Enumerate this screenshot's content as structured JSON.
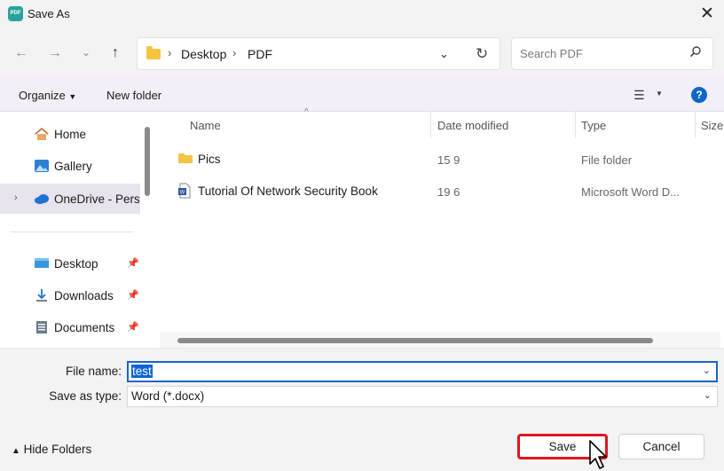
{
  "window": {
    "title": "Save As",
    "app_icon_text": "PDF"
  },
  "navigation": {
    "breadcrumb": [
      "Desktop",
      "PDF"
    ],
    "search_placeholder": "Search PDF"
  },
  "commandbar": {
    "organize": "Organize",
    "new_folder": "New folder"
  },
  "sidebar": {
    "items": [
      {
        "label": "Home",
        "icon": "home-icon"
      },
      {
        "label": "Gallery",
        "icon": "gallery-icon"
      },
      {
        "label": "OneDrive - Perso",
        "icon": "onedrive-icon",
        "selected": true
      },
      {
        "label": "Desktop",
        "icon": "desktop-icon",
        "pinned": true
      },
      {
        "label": "Downloads",
        "icon": "download-icon",
        "pinned": true
      },
      {
        "label": "Documents",
        "icon": "documents-icon",
        "pinned": true
      }
    ]
  },
  "filelist": {
    "columns": [
      "Name",
      "Date modified",
      "Type",
      "Size"
    ],
    "rows": [
      {
        "name": "Pics",
        "date": "15 9",
        "type": "File folder",
        "icon": "folder-icon"
      },
      {
        "name": "Tutorial Of Network Security Book",
        "date": "19 6",
        "type": "Microsoft Word D...",
        "icon": "word-doc-icon"
      }
    ]
  },
  "form": {
    "file_name_label": "File name:",
    "file_name_value": "test",
    "save_type_label": "Save as type:",
    "save_type_value": "Word (*.docx)"
  },
  "footer": {
    "hide_folders": "Hide Folders",
    "save": "Save",
    "cancel": "Cancel"
  },
  "colors": {
    "accent": "#0a64d8",
    "highlight_border": "#e2151f",
    "help": "#0e67c8"
  }
}
